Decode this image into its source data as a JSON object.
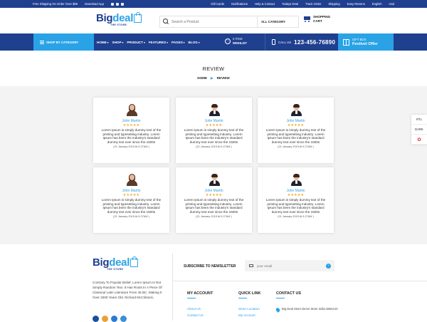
{
  "topbar": {
    "shipping": "Free Shipping On Order Over $99",
    "download": "Download App",
    "links": [
      "Gift Cards",
      "Notifications",
      "Help & Contact",
      "Todays Deal",
      "Track Order",
      "Shipping",
      "Easy Returns",
      "English",
      "Usd"
    ]
  },
  "header": {
    "logo_big": "Big",
    "logo_deal": "deal",
    "logo_tag": "THE STORE",
    "search_placeholder": "Search a Product",
    "category": "ALL CATEGORY",
    "cart_line1": "SHOPPING",
    "cart_line2": "CART"
  },
  "nav": {
    "shop_by_category": "SHOP BY CATEGORY",
    "items": [
      "HOME",
      "SHOP",
      "PRODUCT",
      "FEATURES",
      "PAGES",
      "BLOG"
    ],
    "wishlist_count": "0 ITEM",
    "wishlist_label": "WISHLIST",
    "call_label": "CALL US",
    "phone": "123-456-76890",
    "gift_line1": "GIFT BOX",
    "gift_line2": "Festivel Offer"
  },
  "page": {
    "title": "REVIEW",
    "breadcrumb_home": "HOME",
    "breadcrumb_current": "REVIEW"
  },
  "reviews": [
    {
      "name": "John Martin",
      "stars": "★★★★★",
      "text": "Lorem Ipsum is simply dummy text of the printing and typesetting industry. Lorem Ipsum has been the industry's standard dummy text ever since the 1500s",
      "date": "(21 January 2019 At 9.27AM )"
    },
    {
      "name": "John Martin",
      "stars": "★★★★★",
      "text": "Lorem Ipsum is simply dummy text of the printing and typesetting industry. Lorem Ipsum has been the industry's standard dummy text ever since the 1500s",
      "date": "(21 January 2019 At 9.27AM )"
    },
    {
      "name": "John Martin",
      "stars": "★★★★★",
      "text": "Lorem Ipsum is simply dummy text of the printing and typesetting industry. Lorem Ipsum has been the industry's standard dummy text ever since the 1500s",
      "date": "(21 January 2019 At 9.27AM )"
    },
    {
      "name": "John Martin",
      "stars": "★★★★★",
      "text": "Lorem Ipsum is simply dummy text of the printing and typesetting industry. Lorem Ipsum has been the industry's standard dummy text ever since the 1500s",
      "date": "(21 January 2019 At 9.27AM )"
    },
    {
      "name": "John Martin",
      "stars": "★★★★★",
      "text": "Lorem Ipsum is simply dummy text of the printing and typesetting industry. Lorem Ipsum has been the industry's standard dummy text ever since the 1500s",
      "date": "(21 January 2019 At 9.27AM )"
    },
    {
      "name": "John Martin",
      "stars": "★★★★★",
      "text": "Lorem Ipsum is simply dummy text of the printing and typesetting industry. Lorem Ipsum has been the industry's standard dummy text ever since the 1500s",
      "date": "(21 January 2019 At 9.27AM )"
    }
  ],
  "side": {
    "rtl": "RTL",
    "dark": "DARK"
  },
  "footer": {
    "desc": "Contrary To Popular Belief, Lorem Ipsum Is Not Simply Random Text. It Has Roots In A Piece Of Classical Latin Literature From 45 BC, Making It Over 2000 Years Old. Richard McClintock,",
    "newsletter_label": "SUBSCRIBE TO NEWSLETTER",
    "email_placeholder": "your email",
    "my_account": "MY ACCOUNT",
    "quick_link": "QUICK LINK",
    "contact_us": "CONTACT US",
    "account_links": [
      "About Us",
      "Contact Us"
    ],
    "quick_links": [
      "Store Location",
      "My Account"
    ],
    "address": "Big Deal Store Demo Store India-3654123"
  },
  "colors": {
    "primary": "#1f3f8f",
    "accent": "#29a3e6",
    "star": "#f5a623"
  }
}
